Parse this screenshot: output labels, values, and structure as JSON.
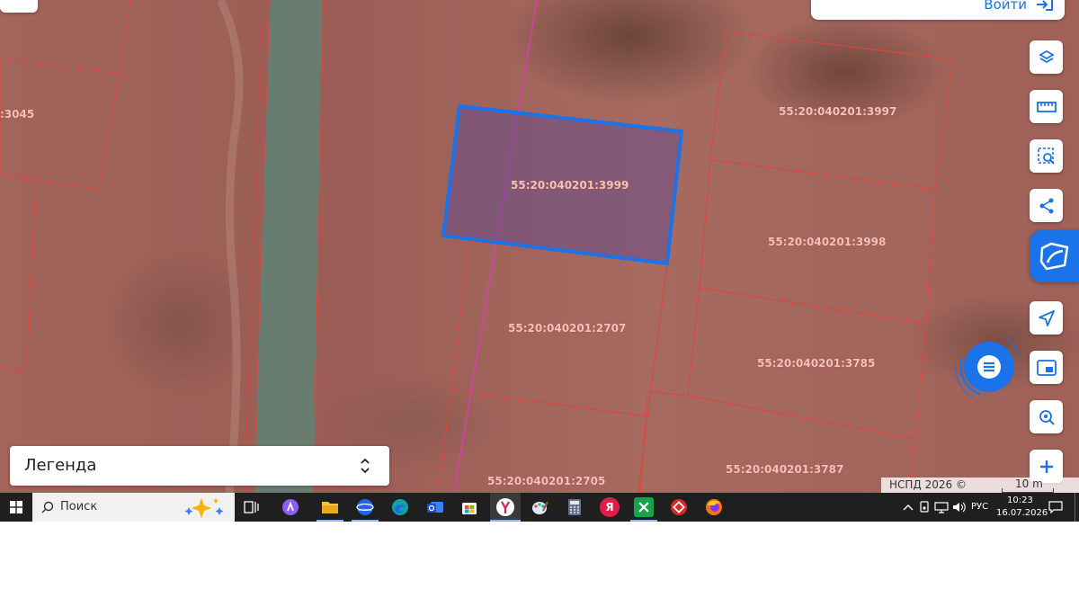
{
  "header": {
    "login_label": "Войти"
  },
  "map": {
    "selected_parcel": "55:20:040201:3999",
    "parcels": [
      "55:20:040201:3999",
      "55:20:040201:3997",
      "55:20:040201:3998",
      "55:20:040201:2707",
      "55:20:040201:3785",
      "55:20:040201:2705",
      "55:20:040201:3787"
    ],
    "partial_label": ":3045",
    "attribution": "НСПД 2026 ©",
    "scale": "10 m",
    "colors": {
      "selection": "#1a73e8",
      "parcel_border": "#e0453e",
      "accent": "#1a73e8"
    }
  },
  "toolbar": {
    "tools": [
      "layers-icon",
      "ruler-icon",
      "area-select-icon",
      "share-icon",
      "main-logo-icon",
      "navigate-icon",
      "picture-in-picture-icon",
      "locate-search-icon",
      "zoom-in-icon"
    ]
  },
  "legend": {
    "label": "Легенда"
  },
  "taskbar": {
    "search_placeholder": "Поиск",
    "language": "РУС",
    "time": "10:23",
    "date": "16.07.2026",
    "yandex_letter": "Я"
  }
}
